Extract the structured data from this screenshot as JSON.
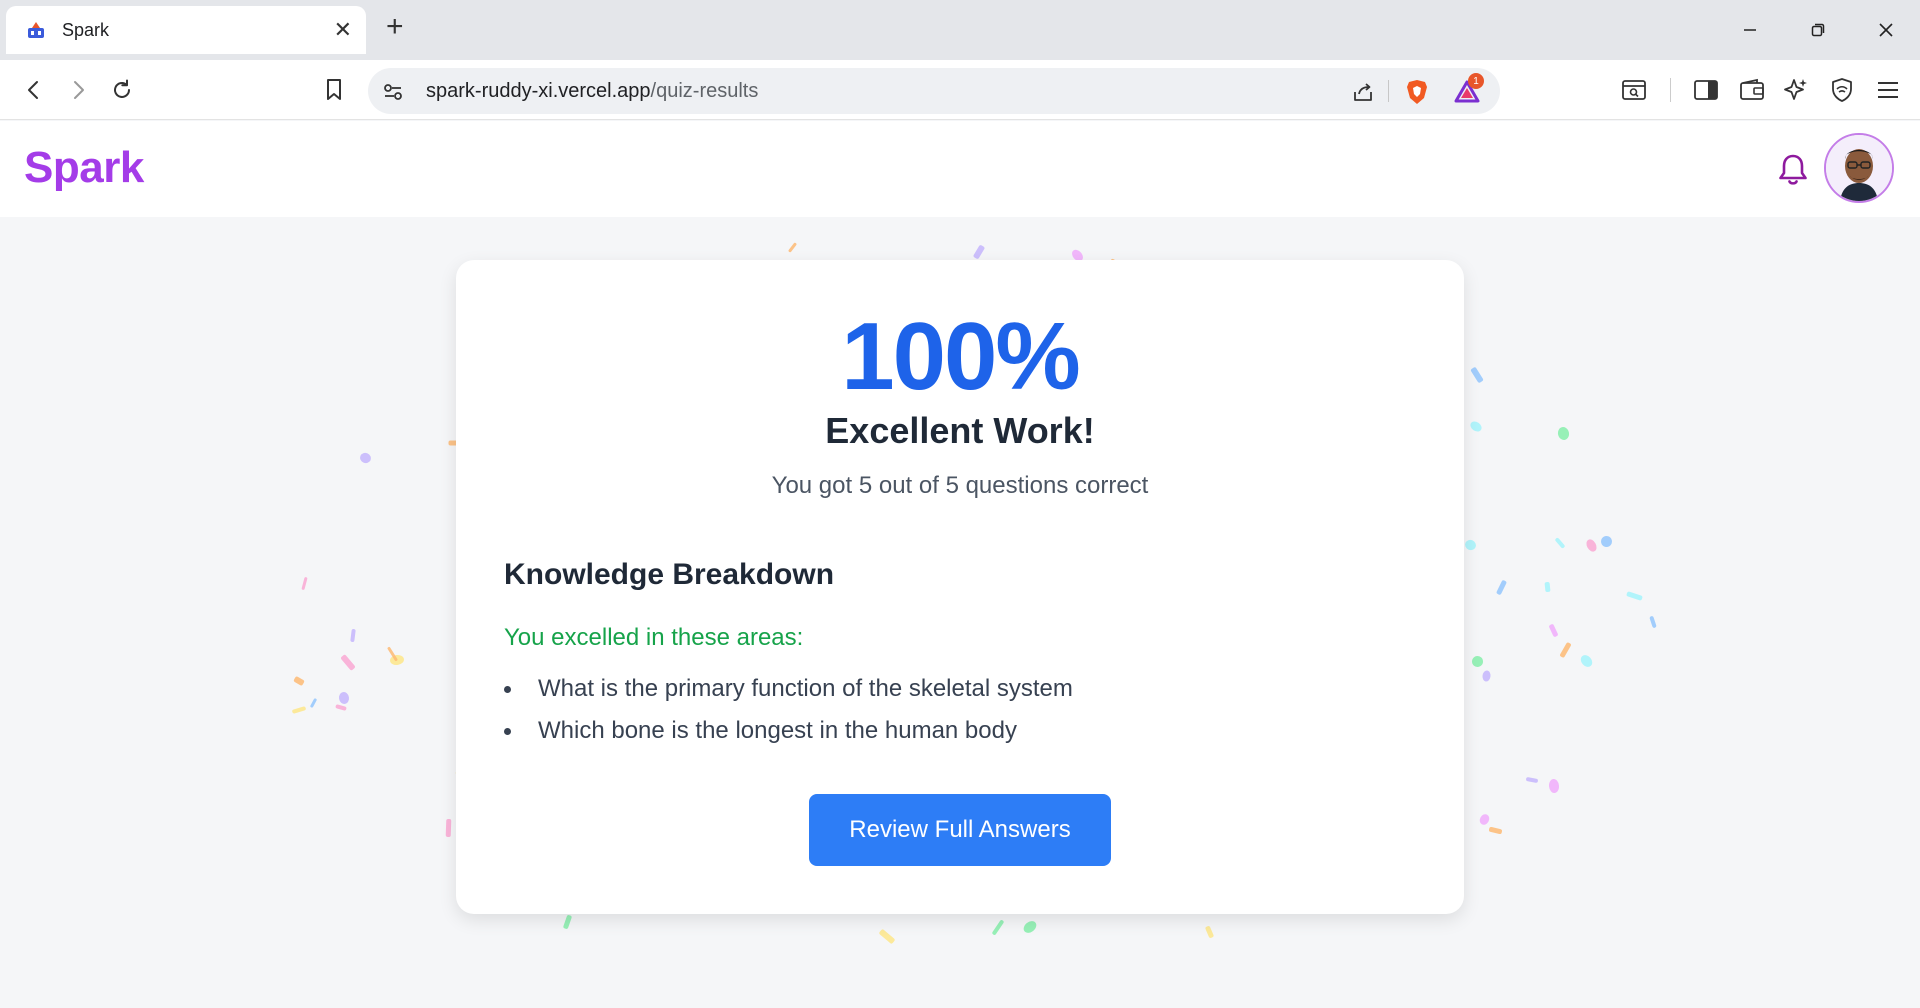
{
  "browser": {
    "tab_title": "Spark",
    "url_host": "spark-ruddy-xi.vercel.app",
    "url_path": "/quiz-results",
    "brave_badge_count": "1"
  },
  "app": {
    "logo": "Spark",
    "brand_color": "#a43ce8"
  },
  "results": {
    "score": "100%",
    "headline": "Excellent Work!",
    "summary": "You got 5 out of 5 questions correct",
    "breakdown_title": "Knowledge Breakdown",
    "excelled_label": "You excelled in these areas:",
    "excelled_areas": [
      "What is the primary function of the skeletal system",
      "Which bone is the longest in the human body"
    ],
    "review_button": "Review Full Answers"
  },
  "colors": {
    "score": "#1e63e9",
    "success": "#16a34a",
    "button": "#2d7df6",
    "confetti": [
      "#f9a8d4",
      "#c4b5fd",
      "#93c5fd",
      "#86efac",
      "#fde68a",
      "#fdba74",
      "#a5f3fc",
      "#f0abfc"
    ]
  }
}
